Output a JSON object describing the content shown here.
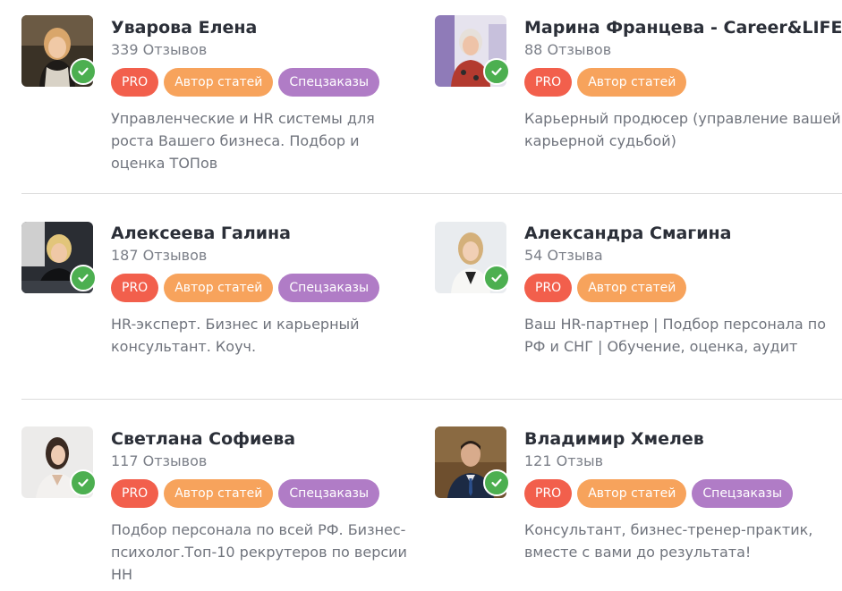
{
  "labels": {
    "pro": "PRO",
    "author": "Автор статей",
    "special": "Спецзаказы"
  },
  "experts": [
    {
      "name": "Уварова Елена",
      "reviews": "339 Отзывов",
      "description": "Управленческие и HR системы для роста Вашего бизнеса. Подбор и оценка ТОПов",
      "badges": [
        "pro",
        "author",
        "special"
      ]
    },
    {
      "name": "Марина Францева - Career&LIFE",
      "reviews": "88 Отзывов",
      "description": "Карьерный продюсер (управление вашей карьерной судьбой)",
      "badges": [
        "pro",
        "author"
      ]
    },
    {
      "name": "Алексеева Галина",
      "reviews": "187 Отзывов",
      "description": "HR-эксперт. Бизнес и карьерный консультант. Коуч.",
      "badges": [
        "pro",
        "author",
        "special"
      ]
    },
    {
      "name": "Александра Смагина",
      "reviews": "54 Отзыва",
      "description": "Ваш HR-партнер | Подбор персонала по РФ и СНГ | Обучение, оценка, аудит",
      "badges": [
        "pro",
        "author"
      ]
    },
    {
      "name": "Светлана Софиева",
      "reviews": "117 Отзывов",
      "description": "Подбор персонала по всей РФ. Бизнес-психолог.Топ-10 рекрутеров по версии НН",
      "badges": [
        "pro",
        "author",
        "special"
      ]
    },
    {
      "name": "Владимир Хмелев",
      "reviews": "121 Отзыв",
      "description": "Консультант, бизнес-тренер-практик, вместе с вами до результата!",
      "badges": [
        "pro",
        "author",
        "special"
      ]
    }
  ],
  "colors": {
    "pro": "#f25f4c",
    "author": "#f7a35c",
    "special": "#b07cc6",
    "verified": "#4caf50"
  },
  "icons": {
    "verified": "checkmark-icon"
  }
}
